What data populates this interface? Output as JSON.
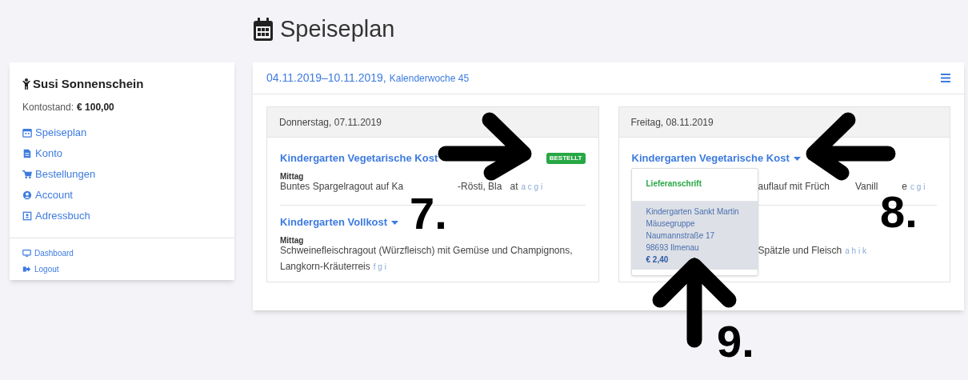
{
  "page_title": "Speiseplan",
  "user": {
    "name": "Susi Sonnenschein",
    "balance_label": "Kontostand:",
    "balance": "€ 100,00"
  },
  "nav": [
    {
      "label": "Speiseplan"
    },
    {
      "label": "Konto"
    },
    {
      "label": "Bestellungen"
    },
    {
      "label": "Account"
    },
    {
      "label": "Adressbuch"
    }
  ],
  "nav_secondary": [
    {
      "label": "Dashboard"
    },
    {
      "label": "Logout"
    }
  ],
  "week": {
    "range": "04.11.2019–10.11.2019,",
    "week_label": "Kalenderwoche 45"
  },
  "days": [
    {
      "date": "Donnerstag, 07.11.2019",
      "dishes": [
        {
          "title": "Kindergarten Vegetarische Kost",
          "badge": "BESTELLT",
          "meal": "Mittag",
          "description": [
            "Buntes Spargelragout auf Ka",
            "-Rösti, Bla",
            "at"
          ],
          "allergens": "a c g i"
        },
        {
          "title": "Kindergarten Vollkost",
          "meal": "Mittag",
          "description": [
            "Schweinefleischragout (Würzfleisch) mit Gemüse und Champignons, Langkorn-Kräuterreis"
          ],
          "allergens": "f g i"
        }
      ]
    },
    {
      "date": "Freitag, 08.11.2019",
      "dropdown": {
        "header": "Lieferanschrift",
        "lines": [
          "Kindergarten Sankt Martin",
          "Mäusegruppe",
          "Naumannstraße 17",
          "98693 Ilmenau"
        ],
        "price": "€ 2,40"
      },
      "dishes": [
        {
          "title": "Kindergarten Vegetarische Kost",
          "description": [
            "auflauf mit Früch",
            "Vanill",
            "e"
          ],
          "allergens": "c g i"
        },
        {
          "description": [
            "Spätzle und Fleisch"
          ],
          "allergens": "a h i k"
        }
      ]
    }
  ],
  "annotations": [
    {
      "label": "7.",
      "kind": "right"
    },
    {
      "label": "8.",
      "kind": "left"
    },
    {
      "label": "9.",
      "kind": "up"
    }
  ]
}
